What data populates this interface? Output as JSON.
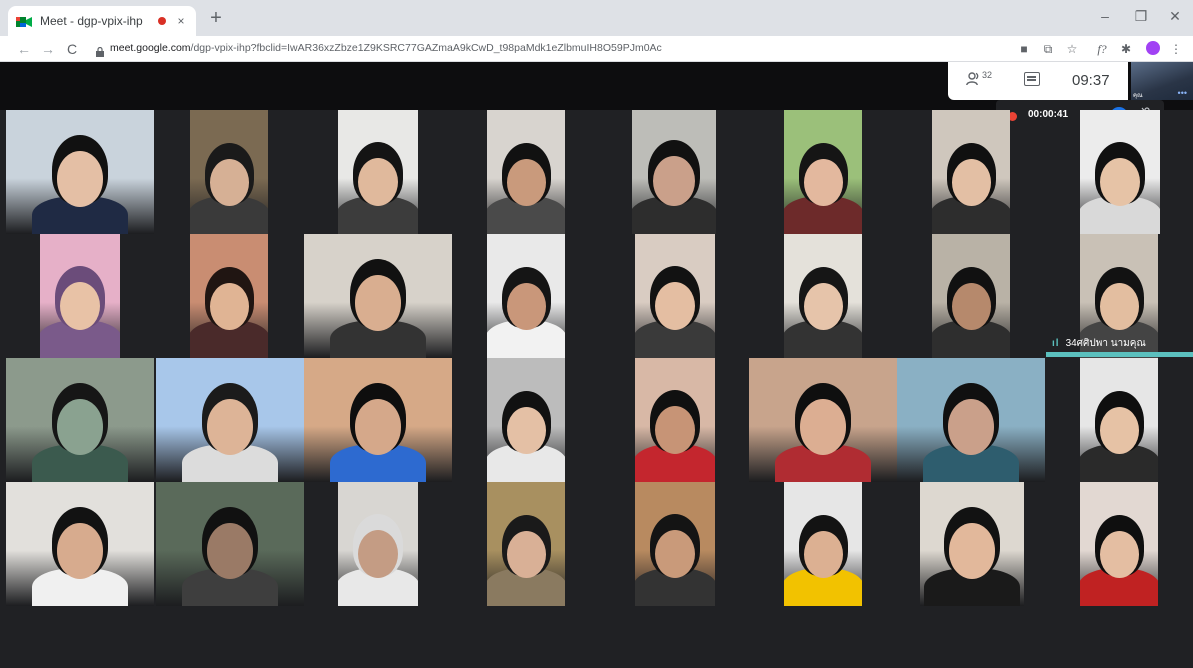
{
  "browser": {
    "tab_title": "Meet - dgp-vpix-ihp",
    "tab_close": "×",
    "new_tab": "+",
    "url_host": "meet.google.com",
    "url_path": "/dgp-vpix-ihp?fbclid=IwAR36xzZbze1Z9KSRC77GAZmaA9kCwD_t98paMdk1eZlbmuIH8O59PJm0Ac",
    "nav": {
      "back": "←",
      "forward": "→",
      "reload": "C"
    },
    "window": {
      "minimize": "–",
      "maximize": "❐",
      "close": "✕"
    },
    "extensions": [
      "■",
      "⧉",
      "☆",
      "f?",
      "✱",
      "⋮"
    ]
  },
  "meet": {
    "people_count": "32",
    "clock": "09:37",
    "self_name": "คุณ",
    "self_more": "•••",
    "recording_time": "00:00:41",
    "mute_glyph": "🎙",
    "speaker_wave": "ıl",
    "speaker_name": "34ศศิปพา นามคุณ"
  },
  "colors": {
    "meet_bg": "#202124",
    "record_red": "#ea4335",
    "speaker_teal": "#5bc0be",
    "accent_blue": "#1a73e8"
  }
}
